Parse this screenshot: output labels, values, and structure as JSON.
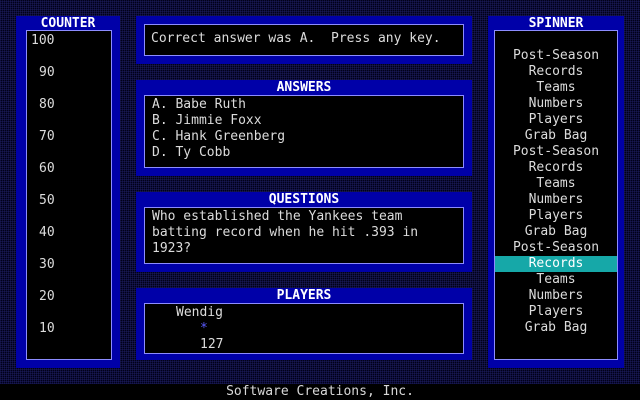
{
  "counter": {
    "title": "COUNTER",
    "values": [
      "100",
      "90",
      "80",
      "70",
      "60",
      "50",
      "40",
      "30",
      "20",
      "10"
    ]
  },
  "message": {
    "text": "Correct answer was A.  Press any key."
  },
  "answers": {
    "title": "ANSWERS",
    "items": [
      "A. Babe Ruth",
      "B. Jimmie Foxx",
      "C. Hank Greenberg",
      "D. Ty Cobb"
    ]
  },
  "questions": {
    "title": "QUESTIONS",
    "lines": [
      "Who established the Yankees team",
      "batting record when he hit .393 in",
      "1923?"
    ]
  },
  "players": {
    "title": "PLAYERS",
    "name": "Wendig",
    "marker": "*",
    "score": "127"
  },
  "spinner": {
    "title": "SPINNER",
    "items": [
      "Post-Season",
      "Records",
      "Teams",
      "Numbers",
      "Players",
      "Grab Bag",
      "Post-Season",
      "Records",
      "Teams",
      "Numbers",
      "Players",
      "Grab Bag",
      "Post-Season",
      "Records",
      "Teams",
      "Numbers",
      "Players",
      "Grab Bag"
    ],
    "active_index": 13
  },
  "footer": {
    "text": "Software Creations, Inc."
  },
  "colors": {
    "panel": "#0000a8",
    "highlight": "#16a8a8",
    "marker": "#5a5aff"
  }
}
